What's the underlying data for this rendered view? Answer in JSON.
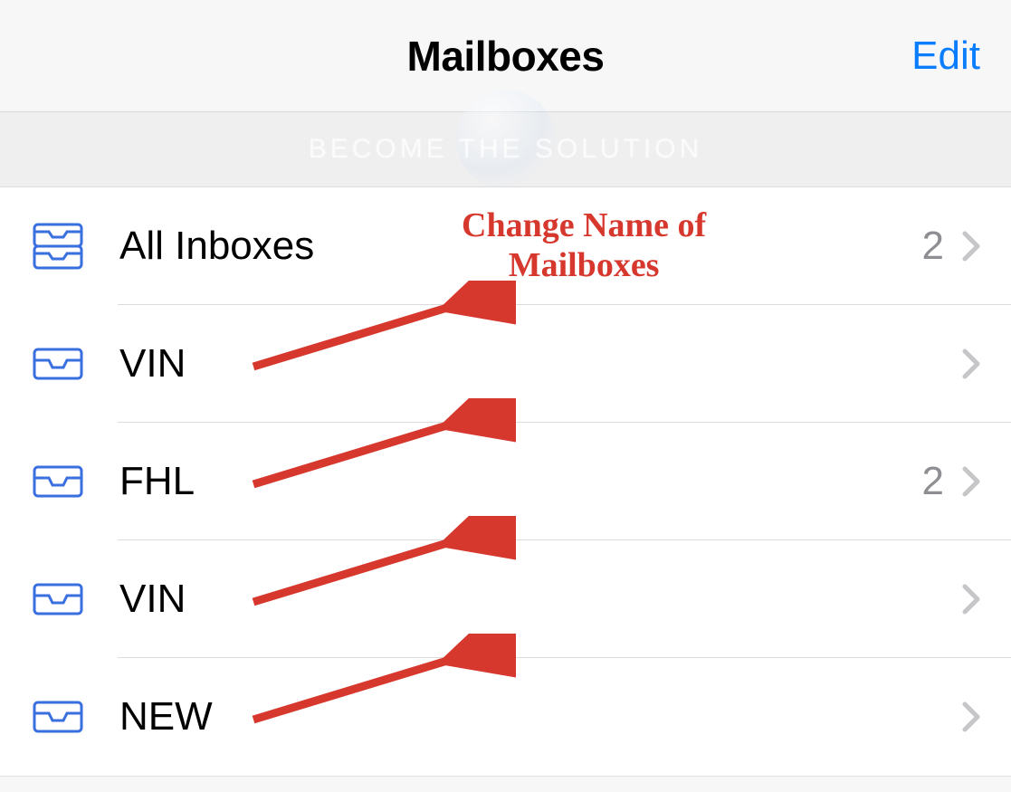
{
  "nav": {
    "title": "Mailboxes",
    "edit_label": "Edit"
  },
  "watermark": {
    "text": "BECOME THE SOLUTION"
  },
  "mailboxes": [
    {
      "label": "All Inboxes",
      "count": "2",
      "icon": "all-inboxes"
    },
    {
      "label": "VIN",
      "count": "",
      "icon": "inbox"
    },
    {
      "label": "FHL",
      "count": "2",
      "icon": "inbox"
    },
    {
      "label": "VIN",
      "count": "",
      "icon": "inbox"
    },
    {
      "label": "NEW",
      "count": "",
      "icon": "inbox"
    }
  ],
  "annotation": {
    "text_line1": "Change Name of",
    "text_line2": "Mailboxes"
  },
  "colors": {
    "accent_blue": "#0a7dff",
    "icon_blue": "#3a6fe0",
    "chevron_gray": "#c6c6c8",
    "count_gray": "#8e8e93",
    "annotation_red": "#d7382e"
  }
}
